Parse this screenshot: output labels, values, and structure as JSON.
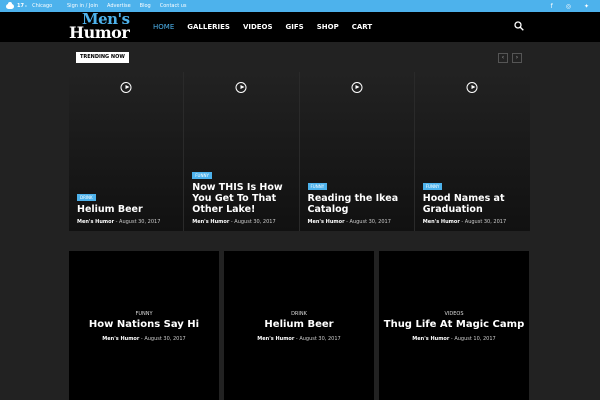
{
  "topbar": {
    "temperature": "17",
    "degree": "C",
    "city": "Chicago",
    "links": [
      "Sign in / Join",
      "Advertise",
      "Blog",
      "Contact us"
    ],
    "social_icons": [
      "facebook-icon",
      "instagram-icon",
      "twitter-icon"
    ]
  },
  "header": {
    "logo_line1": "Men's",
    "logo_line2": "Humor",
    "nav": [
      "HOME",
      "GALLERIES",
      "VIDEOS",
      "GIFS",
      "SHOP",
      "CART"
    ]
  },
  "trending": {
    "label": "TRENDING NOW",
    "prev": "‹",
    "next": "›",
    "slides": [
      {
        "category": "DRINK",
        "title": "Helium Beer",
        "author": "Men's Humor",
        "date": "August 30, 2017"
      },
      {
        "category": "FUNNY",
        "title": "Now THIS Is How You Get To That Other Lake!",
        "author": "Men's Humor",
        "date": "August 30, 2017"
      },
      {
        "category": "FUNNY",
        "title": "Reading the Ikea Catalog",
        "author": "Men's Humor",
        "date": "August 30, 2017"
      },
      {
        "category": "FUNNY",
        "title": "Hood Names at Graduation",
        "author": "Men's Humor",
        "date": "August 30, 2017"
      }
    ]
  },
  "grid": [
    {
      "category": "FUNNY",
      "title": "How Nations Say Hi",
      "author": "Men's Humor",
      "date": "August 30, 2017"
    },
    {
      "category": "DRINK",
      "title": "Helium Beer",
      "author": "Men's Humor",
      "date": "August 30, 2017"
    },
    {
      "category": "VIDEOS",
      "title": "Thug Life At Magic Camp",
      "author": "Men's Humor",
      "date": "August 10, 2017"
    }
  ],
  "separator": "-",
  "colors": {
    "accent": "#4db2ec",
    "background": "#222222",
    "header": "#000000"
  }
}
